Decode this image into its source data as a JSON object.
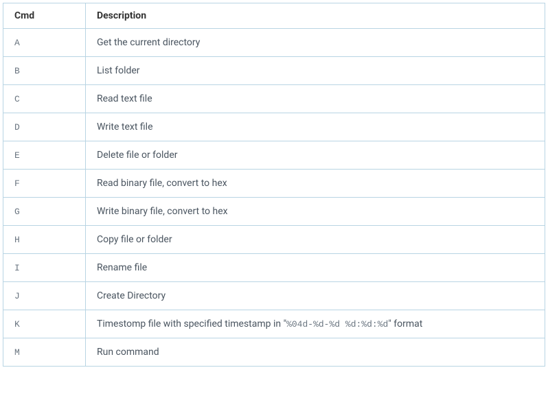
{
  "headers": {
    "cmd": "Cmd",
    "description": "Description"
  },
  "rows": [
    {
      "cmd": "A",
      "desc_pre": "Get the current directory",
      "desc_code": "",
      "desc_post": ""
    },
    {
      "cmd": "B",
      "desc_pre": "List folder",
      "desc_code": "",
      "desc_post": ""
    },
    {
      "cmd": "C",
      "desc_pre": "Read text file",
      "desc_code": "",
      "desc_post": ""
    },
    {
      "cmd": "D",
      "desc_pre": "Write text file",
      "desc_code": "",
      "desc_post": ""
    },
    {
      "cmd": "E",
      "desc_pre": "Delete file or folder",
      "desc_code": "",
      "desc_post": ""
    },
    {
      "cmd": "F",
      "desc_pre": "Read binary file, convert to hex",
      "desc_code": "",
      "desc_post": ""
    },
    {
      "cmd": "G",
      "desc_pre": "Write binary file, convert to hex",
      "desc_code": "",
      "desc_post": ""
    },
    {
      "cmd": "H",
      "desc_pre": "Copy file or folder",
      "desc_code": "",
      "desc_post": ""
    },
    {
      "cmd": "I",
      "desc_pre": "Rename file",
      "desc_code": "",
      "desc_post": ""
    },
    {
      "cmd": "J",
      "desc_pre": "Create Directory",
      "desc_code": "",
      "desc_post": ""
    },
    {
      "cmd": "K",
      "desc_pre": "Timestomp file with specified timestamp in \"",
      "desc_code": "%04d-%d-%d %d:%d:%d",
      "desc_post": "\" format"
    },
    {
      "cmd": "M",
      "desc_pre": "Run command",
      "desc_code": "",
      "desc_post": ""
    }
  ]
}
